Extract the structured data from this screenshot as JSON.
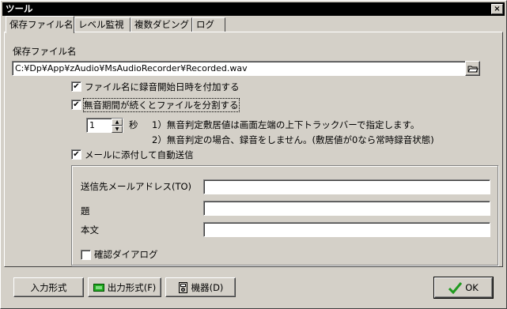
{
  "window": {
    "title": "ツール",
    "close_glyph": "×"
  },
  "tabs": [
    {
      "label": "保存ファイル名"
    },
    {
      "label": "レベル監視"
    },
    {
      "label": "複数ダビング"
    },
    {
      "label": "ログ"
    }
  ],
  "save": {
    "section_label": "保存ファイル名",
    "path_value": "C:¥Dp¥App¥zAudio¥MsAudioRecorder¥Recorded.wav"
  },
  "options": {
    "add_datetime": {
      "label": "ファイル名に録音開始日時を付加する",
      "checked": true,
      "mark": "✔"
    },
    "split_silence": {
      "label": "無音期間が続くとファイルを分割する",
      "checked": true,
      "mark": "✔"
    },
    "seconds_value": "1",
    "seconds_unit": "秒",
    "note1": "1）無音判定敷居値は画面左端の上下トラックバーで指定します。",
    "note2": "2）無音判定の場合、録音をしません。(敷居値が0なら常時録音状態)",
    "email_send": {
      "label": "メールに添付して自動送信",
      "checked": true,
      "mark": "✔"
    }
  },
  "mail": {
    "to_label": "送信先メールアドレス(TO)",
    "to_value": "",
    "subject_label": "題",
    "subject_value": "",
    "body_label": "本文",
    "body_value": "",
    "confirm_label": "確認ダイアログ",
    "confirm_checked": false
  },
  "buttons": {
    "input_format": "入力形式",
    "output_format": "出力形式(F)",
    "devices": "機器(D)",
    "ok": "OK"
  },
  "colors": {
    "ok_check": "#1f9a1f",
    "output_icon": "#22aa22"
  }
}
